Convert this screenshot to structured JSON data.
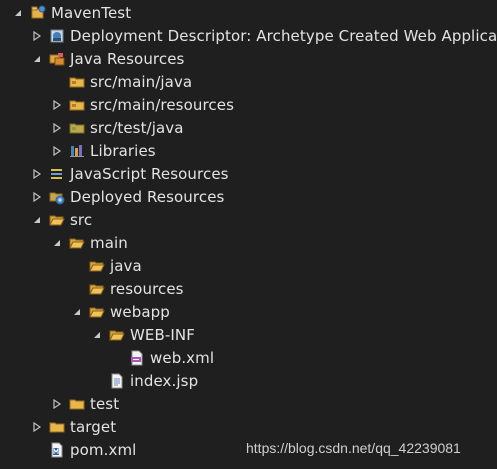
{
  "tree": {
    "root": "MavenTest",
    "deployment_descriptor": "Deployment Descriptor: Archetype Created Web Applicatio",
    "java_resources": "Java Resources",
    "src_main_java": "src/main/java",
    "src_main_resources": "src/main/resources",
    "src_test_java": "src/test/java",
    "libraries": "Libraries",
    "javascript_resources": "JavaScript Resources",
    "deployed_resources": "Deployed Resources",
    "src": "src",
    "main": "main",
    "java": "java",
    "resources": "resources",
    "webapp": "webapp",
    "web_inf": "WEB-INF",
    "web_xml": "web.xml",
    "index_jsp": "index.jsp",
    "test": "test",
    "target": "target",
    "pom_xml": "pom.xml"
  },
  "watermark": "https://blog.csdn.net/qq_42239081",
  "colors": {
    "background": "#1f1f1f",
    "text": "#e3e3e3",
    "folder": "#e8b64a",
    "twisty": "#bfbfbf"
  }
}
